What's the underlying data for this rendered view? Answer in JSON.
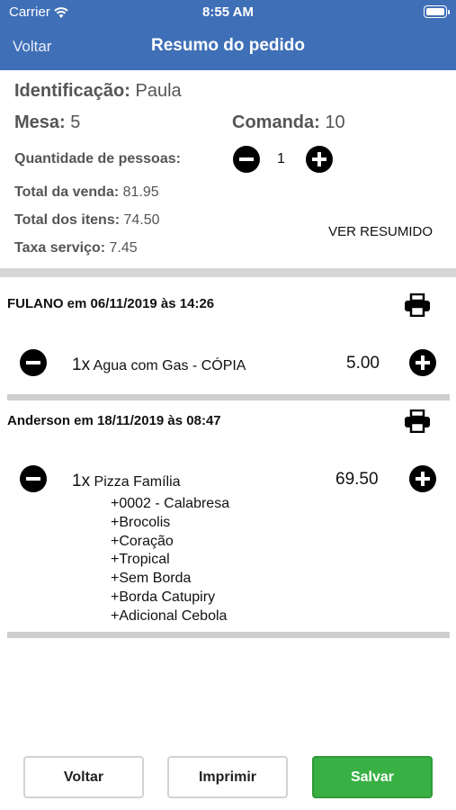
{
  "status_bar": {
    "carrier": "Carrier",
    "time": "8:55 AM"
  },
  "nav": {
    "back_label": "Voltar",
    "title": "Resumo do pedido"
  },
  "summary": {
    "identificacao_label": "Identificação:",
    "identificacao_value": "Paula",
    "mesa_label": "Mesa:",
    "mesa_value": "5",
    "comanda_label": "Comanda:",
    "comanda_value": "10",
    "qty_people_label": "Quantidade de pessoas:",
    "qty_people_value": "1",
    "total_venda_label": "Total da venda:",
    "total_venda_value": "81.95",
    "total_itens_label": "Total dos itens:",
    "total_itens_value": "74.50",
    "taxa_label": "Taxa serviço:",
    "taxa_value": "7.45",
    "ver_resumido": "VER RESUMIDO"
  },
  "orders": [
    {
      "header": "FULANO em 06/11/2019 às 14:26",
      "qty": "1x",
      "name": "Agua com Gas - CÓPIA",
      "price": "5.00",
      "modifiers": []
    },
    {
      "header": "Anderson em 18/11/2019 às 08:47",
      "qty": "1x",
      "name": "Pizza Família",
      "price": "69.50",
      "modifiers": [
        "+0002 - Calabresa",
        "+Brocolis",
        "+Coração",
        "+Tropical",
        "+Sem Borda",
        "+Borda Catupiry",
        "+Adicional Cebola"
      ]
    }
  ],
  "buttons": {
    "voltar": "Voltar",
    "imprimir": "Imprimir",
    "salvar": "Salvar"
  },
  "colors": {
    "header_blue": "#3f6fb7",
    "save_green": "#39b044"
  },
  "icons": {
    "wifi": "wifi-icon",
    "battery": "battery-icon",
    "print": "printer-icon",
    "minus": "minus-circle-icon",
    "plus": "plus-circle-icon"
  }
}
